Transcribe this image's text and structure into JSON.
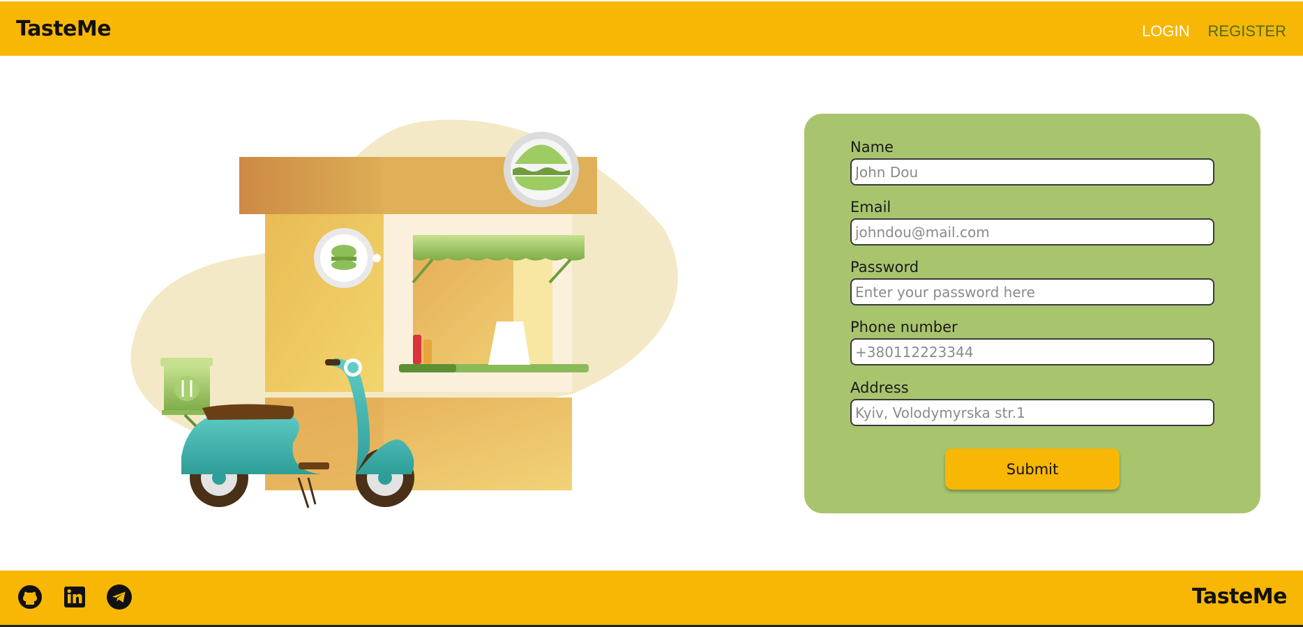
{
  "header": {
    "logo": "TasteMe",
    "nav": {
      "login": "LOGIN",
      "register": "REGISTER"
    }
  },
  "illustration": {
    "icon": "food-truck-scooter-illustration"
  },
  "form": {
    "fields": [
      {
        "label": "Name",
        "placeholder": "John Dou"
      },
      {
        "label": "Email",
        "placeholder": "johndou@mail.com"
      },
      {
        "label": "Password",
        "placeholder": "Enter your password here"
      },
      {
        "label": "Phone number",
        "placeholder": "+380112223344"
      },
      {
        "label": "Address",
        "placeholder": "Kyiv, Volodymyrska str.1"
      }
    ],
    "submit": "Submit"
  },
  "footer": {
    "logo": "TasteMe",
    "social": [
      "github-icon",
      "linkedin-icon",
      "telegram-icon"
    ]
  },
  "colors": {
    "primary": "#f8b704",
    "card": "#a8c56e",
    "nav_active": "#ffffff",
    "nav_link": "#4d6b22"
  }
}
